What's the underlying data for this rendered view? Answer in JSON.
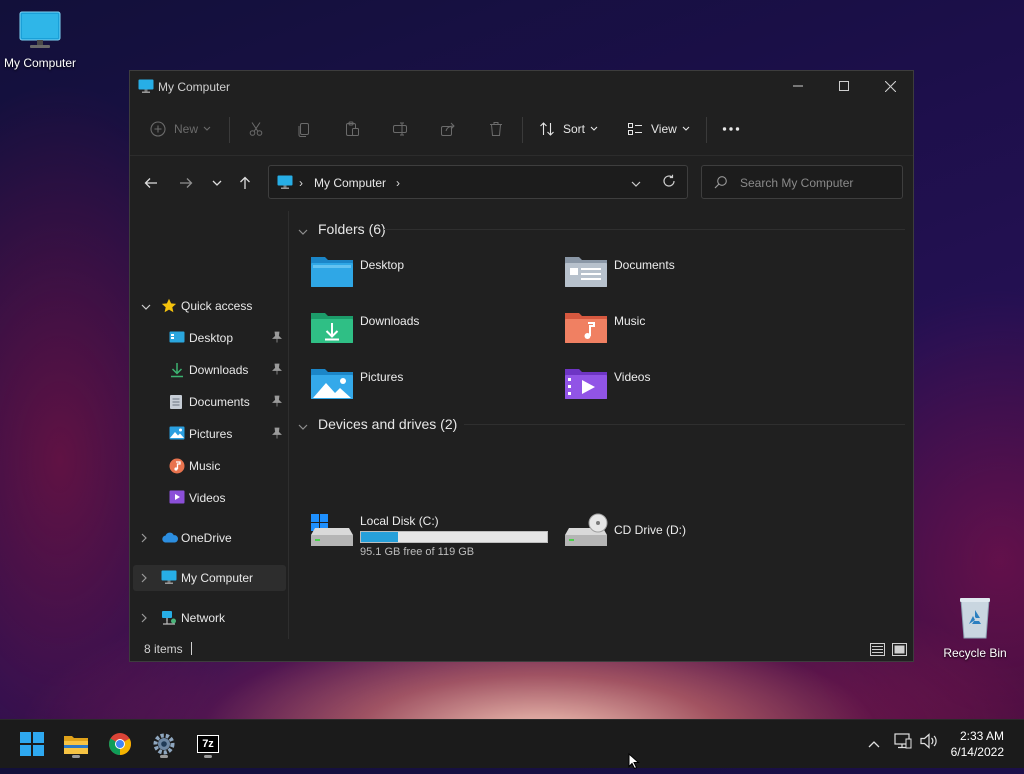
{
  "desktop": {
    "icons": [
      {
        "label": "My Computer",
        "icon": "monitor-icon"
      },
      {
        "label": "Recycle Bin",
        "icon": "recycle-bin-icon"
      }
    ]
  },
  "window": {
    "title": "My Computer",
    "title_icon": "monitor-icon",
    "controls": {
      "minimize": "minimize-icon",
      "maximize": "maximize-icon",
      "close": "close-icon"
    }
  },
  "toolbar": {
    "new_label": "New",
    "sort_label": "Sort",
    "view_label": "View",
    "icons": [
      "plus-circle-icon",
      "cut-icon",
      "copy-icon",
      "paste-icon",
      "rename-icon",
      "share-icon",
      "delete-icon",
      "sort-icon",
      "view-icon",
      "more-icon"
    ]
  },
  "navigation": {
    "address_text": "My Computer",
    "search_placeholder": "Search My Computer"
  },
  "sidebar": {
    "quick_access": "Quick access",
    "items": [
      {
        "label": "Desktop",
        "pinned": true
      },
      {
        "label": "Downloads",
        "pinned": true
      },
      {
        "label": "Documents",
        "pinned": true
      },
      {
        "label": "Pictures",
        "pinned": true
      },
      {
        "label": "Music",
        "pinned": false
      },
      {
        "label": "Videos",
        "pinned": false
      }
    ],
    "onedrive": "OneDrive",
    "my_computer": "My Computer",
    "network": "Network",
    "selected": "My Computer"
  },
  "content": {
    "folders_header": "Folders (6)",
    "folders": [
      {
        "label": "Desktop"
      },
      {
        "label": "Documents"
      },
      {
        "label": "Downloads"
      },
      {
        "label": "Music"
      },
      {
        "label": "Pictures"
      },
      {
        "label": "Videos"
      }
    ],
    "drives_header": "Devices and drives (2)",
    "drives": [
      {
        "label": "Local Disk (C:)",
        "free_text": "95.1 GB free of 119 GB",
        "used_fraction": 0.2
      },
      {
        "label": "CD Drive (D:)"
      }
    ]
  },
  "statusbar": {
    "count": "8 items"
  },
  "taskbar": {
    "apps": [
      "start-icon",
      "file-explorer-icon",
      "chrome-icon",
      "settings-icon",
      "7zip-icon"
    ],
    "app_7z_label": "7z",
    "time": "2:33 AM",
    "date": "6/14/2022"
  },
  "colors": {
    "window_bg": "#202020",
    "accent": "#26a0da",
    "taskbar_bg": "#1b1b1b"
  }
}
